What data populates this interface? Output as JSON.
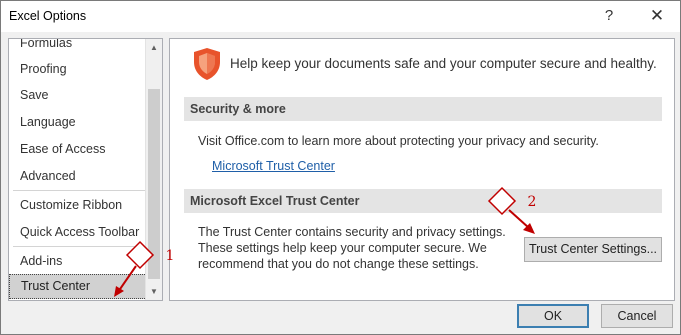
{
  "window": {
    "title": "Excel Options",
    "help_glyph": "?",
    "close_glyph": "✕"
  },
  "sidebar": {
    "items": [
      {
        "label": "Formulas"
      },
      {
        "label": "Proofing"
      },
      {
        "label": "Save"
      },
      {
        "label": "Language"
      },
      {
        "label": "Ease of Access"
      },
      {
        "label": "Advanced"
      },
      {
        "label": "Customize Ribbon"
      },
      {
        "label": "Quick Access Toolbar"
      },
      {
        "label": "Add-ins"
      },
      {
        "label": "Trust Center"
      }
    ],
    "selected": "Trust Center"
  },
  "main": {
    "hero_text": "Help keep your documents safe and your computer secure and healthy.",
    "security_section": {
      "heading": "Security & more",
      "text": "Visit Office.com to learn more about protecting your privacy and security.",
      "link": "Microsoft Trust Center"
    },
    "trust_section": {
      "heading": "Microsoft Excel Trust Center",
      "line1": "The Trust Center contains security and privacy settings.",
      "line2": "These settings help keep your computer secure. We",
      "line3": "recommend that you do not change these settings.",
      "button": "Trust Center Settings..."
    }
  },
  "footer": {
    "ok": "OK",
    "cancel": "Cancel"
  },
  "annotations": {
    "callout_1": "1",
    "callout_2": "2",
    "color": "#c00000"
  },
  "colors": {
    "shield": "#e8532b",
    "link": "#1f5fa8",
    "ok_border": "#3c7fb1"
  }
}
